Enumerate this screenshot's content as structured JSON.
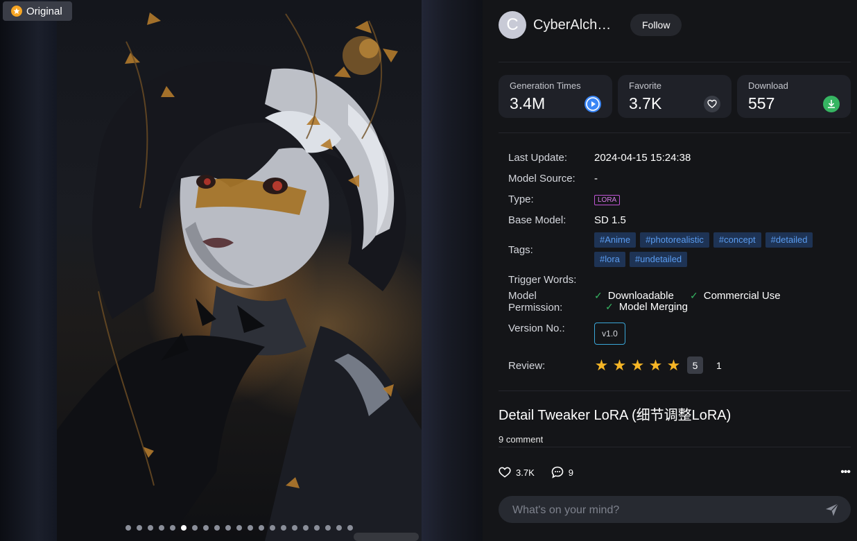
{
  "viewer": {
    "badge_label": "Original",
    "dot_count": 21,
    "active_dot": 5
  },
  "author": {
    "avatar_letter": "C",
    "name": "CyberAlchemist",
    "follow_label": "Follow"
  },
  "stats": [
    {
      "label": "Generation Times",
      "value": "3.4M",
      "icon": "play-icon",
      "color": "#3a86f5"
    },
    {
      "label": "Favorite",
      "value": "3.7K",
      "icon": "heart-icon",
      "color": "#393c45"
    },
    {
      "label": "Download",
      "value": "557",
      "icon": "download-icon",
      "color": "#36b562"
    }
  ],
  "info": {
    "last_update_label": "Last Update:",
    "last_update": "2024-04-15 15:24:38",
    "model_source_label": "Model Source:",
    "model_source": "-",
    "type_label": "Type:",
    "type": "LORA",
    "base_model_label": "Base Model:",
    "base_model": "SD 1.5",
    "tags_label": "Tags:",
    "tags": [
      "#Anime",
      "#photorealistic",
      "#concept",
      "#detailed",
      "#lora",
      "#undetailed"
    ],
    "trigger_words_label": "Trigger Words:",
    "permission_label_1": "Model",
    "permission_label_2": "Permission:",
    "permissions": [
      "Downloadable",
      "Commercial Use",
      "Model Merging"
    ],
    "version_label": "Version No.:",
    "version": "v1.0",
    "review_label": "Review:",
    "review_score": "5",
    "review_count": "1"
  },
  "title": "Detail Tweaker LoRA (细节调整LoRA)",
  "comment_count": "9 comment",
  "actions": {
    "likes": "3.7K",
    "comments": "9"
  },
  "comment_box": {
    "placeholder": "What's on your mind?"
  }
}
